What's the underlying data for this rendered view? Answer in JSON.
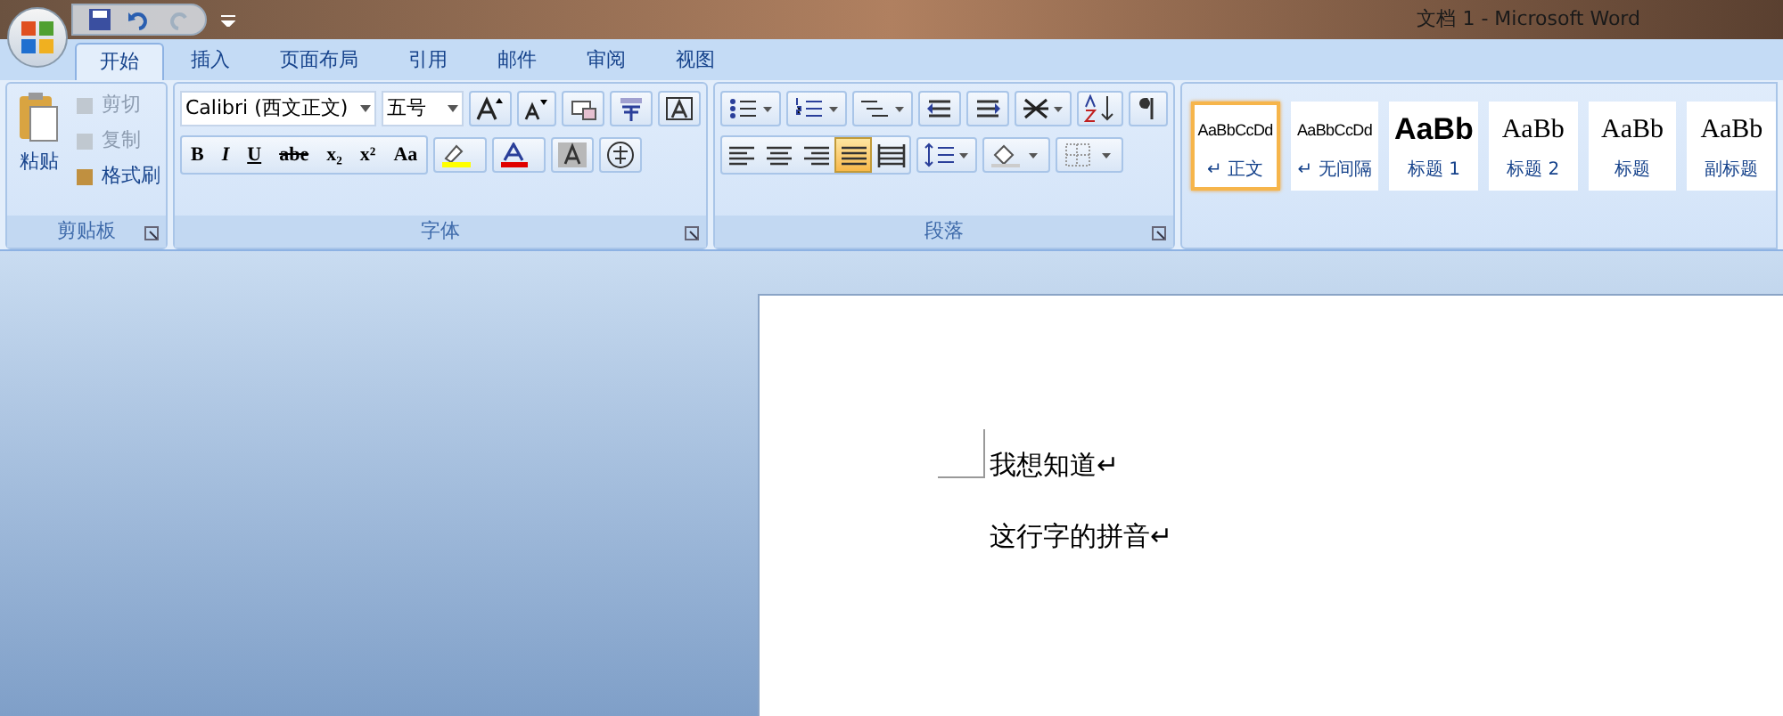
{
  "window": {
    "title": "文档 1 - Microsoft Word"
  },
  "tabs": [
    {
      "label": "开始",
      "selected": true
    },
    {
      "label": "插入",
      "selected": false
    },
    {
      "label": "页面布局",
      "selected": false
    },
    {
      "label": "引用",
      "selected": false
    },
    {
      "label": "邮件",
      "selected": false
    },
    {
      "label": "审阅",
      "selected": false
    },
    {
      "label": "视图",
      "selected": false
    }
  ],
  "clipboard": {
    "paste": "粘贴",
    "items": [
      {
        "label": "剪切",
        "disabled": true
      },
      {
        "label": "复制",
        "disabled": true
      },
      {
        "label": "格式刷",
        "disabled": false
      }
    ],
    "group_label": "剪贴板"
  },
  "font": {
    "name": "Calibri (西文正文)",
    "size": "五号",
    "format_buttons": [
      "B",
      "I",
      "U",
      "abe",
      "x₂",
      "x²",
      "Aa"
    ],
    "group_label": "字体"
  },
  "paragraph": {
    "alignments": [
      {
        "kind": "left",
        "selected": false
      },
      {
        "kind": "center",
        "selected": false
      },
      {
        "kind": "right",
        "selected": false
      },
      {
        "kind": "justify",
        "selected": true
      },
      {
        "kind": "distributed",
        "selected": false
      }
    ],
    "group_label": "段落"
  },
  "styles": [
    {
      "preview": "AaBbCcDd",
      "name": "↵ 正文",
      "kind": "body",
      "selected": true
    },
    {
      "preview": "AaBbCcDd",
      "name": "↵ 无间隔",
      "kind": "body",
      "selected": false
    },
    {
      "preview": "AaBb",
      "name": "标题 1",
      "kind": "heading1",
      "selected": false
    },
    {
      "preview": "AaBb",
      "name": "标题 2",
      "kind": "heading",
      "selected": false
    },
    {
      "preview": "AaBb",
      "name": "标题",
      "kind": "heading",
      "selected": false
    },
    {
      "preview": "AaBb",
      "name": "副标题",
      "kind": "heading",
      "selected": false
    }
  ],
  "document": {
    "lines": [
      "我想知道↵",
      "这行字的拼音↵"
    ]
  }
}
